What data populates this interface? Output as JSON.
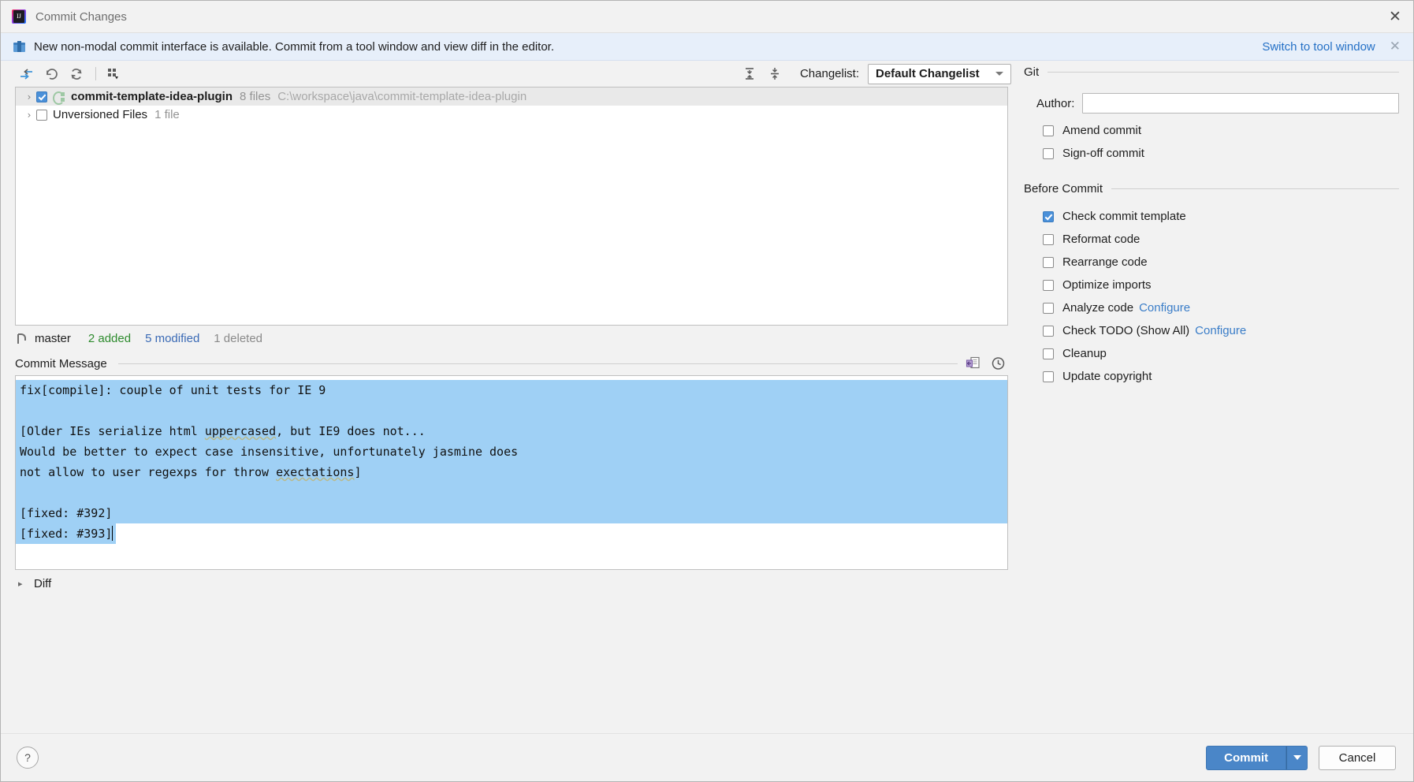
{
  "titlebar": {
    "title": "Commit Changes",
    "app_icon": "intellij-idea-icon",
    "close_glyph": "✕"
  },
  "notification": {
    "icon": "gift-icon",
    "message": "New non-modal commit interface is available. Commit from a tool window and view diff in the editor.",
    "link_label": "Switch to tool window",
    "close_glyph": "✕",
    "link_color": "#2470c6",
    "background": "#e7effa"
  },
  "toolbar": {
    "buttons": [
      {
        "name": "collapse-selection-icon",
        "title": "Move to another changelist"
      },
      {
        "name": "rollback-icon",
        "title": "Rollback"
      },
      {
        "name": "refresh-icon",
        "title": "Refresh"
      },
      {
        "name": "group-by-icon",
        "title": "Group by"
      }
    ],
    "expand_all_icon": "expand-all-icon",
    "collapse_all_icon": "collapse-all-icon",
    "changelist_label": "Changelist:",
    "changelist_value": "Default Changelist"
  },
  "tree": {
    "rows": [
      {
        "expander": "›",
        "checked": true,
        "icon": "module-icon",
        "name": "commit-template-idea-plugin",
        "count": "8 files",
        "path": "C:\\workspace\\java\\commit-template-idea-plugin",
        "selected": true
      },
      {
        "expander": "›",
        "checked": false,
        "icon": "",
        "name": "Unversioned Files",
        "count": "1 file",
        "path": "",
        "selected": false
      }
    ]
  },
  "status": {
    "branch_icon": "git-branch-icon",
    "branch": "master",
    "added": "2 added",
    "modified": "5 modified",
    "deleted": "1 deleted",
    "added_color": "#2e8b2e",
    "modified_color": "#3a6ab5",
    "deleted_color": "#8a8a8a"
  },
  "commit_message": {
    "title": "Commit Message",
    "icons": [
      {
        "name": "insert-template-icon"
      },
      {
        "name": "message-history-clock-icon"
      }
    ],
    "selection_color": "#9fd0f5",
    "lines": [
      {
        "text": "fix[compile]: couple of unit tests for IE 9",
        "selected": true
      },
      {
        "text": "",
        "selected": true
      },
      {
        "text": "[Older IEs serialize html uppercased, but IE9 does not...",
        "selected": true,
        "misspelled": "uppercased"
      },
      {
        "text": "Would be better to expect case insensitive, unfortunately jasmine does",
        "selected": true
      },
      {
        "text": "not allow to user regexps for throw exectations]",
        "selected": true,
        "misspelled": "exectations"
      },
      {
        "text": "",
        "selected": true
      },
      {
        "text": "[fixed: #392]",
        "selected": true
      },
      {
        "text": "[fixed: #393]",
        "selected": true,
        "partial": true
      }
    ]
  },
  "diff": {
    "expander": "▸",
    "label": "Diff"
  },
  "git_panel": {
    "section_title": "Git",
    "author_label": "Author:",
    "author_value": "",
    "author_placeholder": "",
    "options": [
      {
        "label": "Amend commit",
        "checked": false
      },
      {
        "label": "Sign-off commit",
        "checked": false
      }
    ]
  },
  "before_commit_panel": {
    "section_title": "Before Commit",
    "options": [
      {
        "label": "Check commit template",
        "checked": true,
        "configure": ""
      },
      {
        "label": "Reformat code",
        "checked": false,
        "configure": ""
      },
      {
        "label": "Rearrange code",
        "checked": false,
        "configure": ""
      },
      {
        "label": "Optimize imports",
        "checked": false,
        "configure": ""
      },
      {
        "label": "Analyze code",
        "checked": false,
        "configure": "Configure"
      },
      {
        "label": "Check TODO (Show All)",
        "checked": false,
        "configure": "Configure"
      },
      {
        "label": "Cleanup",
        "checked": false,
        "configure": ""
      },
      {
        "label": "Update copyright",
        "checked": false,
        "configure": ""
      }
    ]
  },
  "footer": {
    "help_label": "?",
    "commit_label": "Commit",
    "commit_color": "#4a86c8",
    "cancel_label": "Cancel"
  }
}
